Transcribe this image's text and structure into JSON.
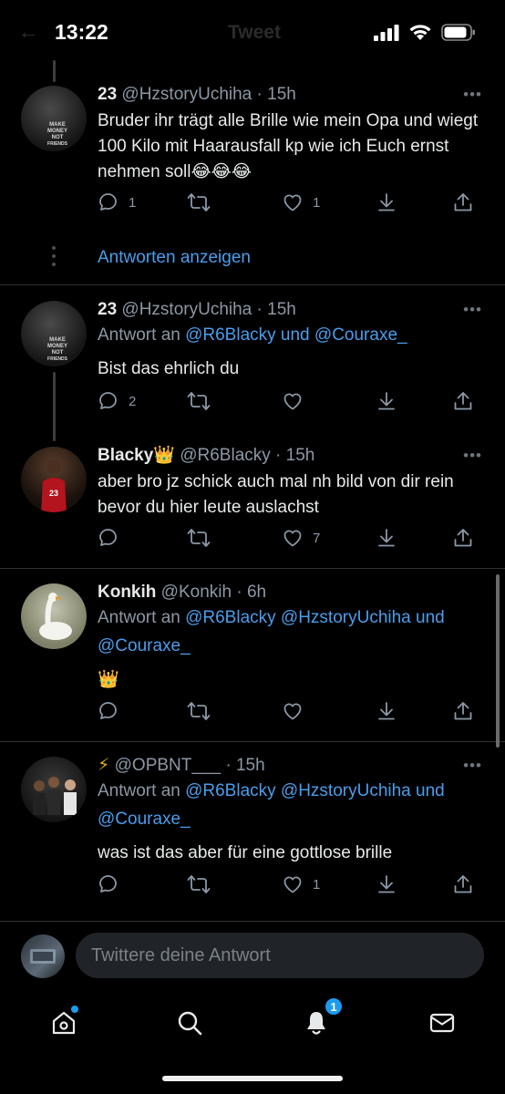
{
  "status_bar": {
    "time": "13:22",
    "ghost_back": "←",
    "ghost_title": "Tweet"
  },
  "tweets": [
    {
      "name": "23",
      "handle": "@HzstoryUchiha",
      "time": "15h",
      "reply_to": null,
      "text": "Bruder ihr trägt alle Brille wie mein Opa und wiegt 100 Kilo mit Haarausfall kp wie ich Euch ernst nehmen soll😂😂😂",
      "avatar_text": [
        "MAKE",
        "MONEY",
        "NOT",
        "FRIENDS"
      ],
      "replies": "1",
      "retweets": "",
      "likes": "1"
    },
    {
      "name": "23",
      "handle": "@HzstoryUchiha",
      "time": "15h",
      "reply_to": {
        "prefix": "Antwort an",
        "mentions": "@R6Blacky und @Couraxe_"
      },
      "text": "Bist das ehrlich du",
      "avatar_text": [
        "MAKE",
        "MONEY",
        "NOT",
        "FRIENDS"
      ],
      "replies": "2",
      "retweets": "",
      "likes": ""
    },
    {
      "name": "Blacky👑",
      "handle": "@R6Blacky",
      "time": "15h",
      "reply_to": null,
      "text": "aber bro jz schick auch mal nh bild von dir rein bevor du hier leute auslachst",
      "replies": "",
      "retweets": "",
      "likes": "7"
    },
    {
      "name": "Konkih",
      "handle": "@Konkih",
      "time": "6h",
      "reply_to": {
        "prefix": "Antwort an",
        "mentions": "@R6Blacky @HzstoryUchiha und @Couraxe_"
      },
      "text": "👑",
      "replies": "",
      "retweets": "",
      "likes": ""
    },
    {
      "name": "⚡",
      "handle": "@OPBNT___",
      "time": "15h",
      "reply_to": {
        "prefix": "Antwort an",
        "mentions": "@R6Blacky @HzstoryUchiha und @Couraxe_"
      },
      "text": "was ist das aber für eine gottlose brille",
      "replies": "",
      "retweets": "",
      "likes": "1"
    }
  ],
  "show_replies": "Antworten anzeigen",
  "more_label": "•••",
  "composer": {
    "placeholder": "Twittere deine Antwort"
  },
  "tabbar": {
    "notifications_badge": "1"
  },
  "colors": {
    "accent": "#1d9bf0",
    "link": "#4a9dec",
    "muted": "#8b98a5",
    "background": "#000000"
  }
}
